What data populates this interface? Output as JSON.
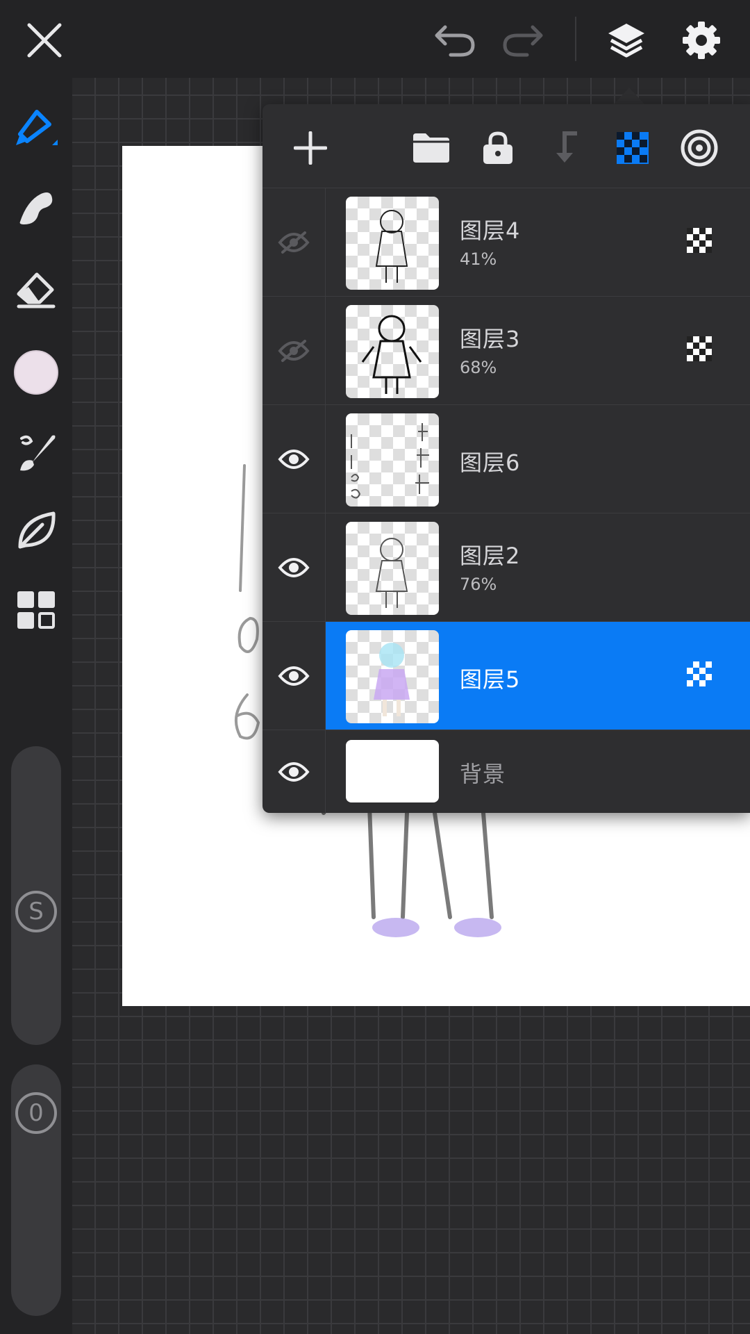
{
  "colors": {
    "accent": "#0a7bf5",
    "current_brush_color": "#ece0ea",
    "panel_bg": "#2e2e30",
    "canvas_paper": "#ffffff"
  },
  "topbar": {
    "icons": [
      "close-icon",
      "undo-icon",
      "redo-icon",
      "layers-icon",
      "settings-icon"
    ]
  },
  "sidebar": {
    "tools": [
      "pen-icon",
      "smudge-icon",
      "eraser-icon",
      "color-swatch",
      "brush-library-icon",
      "leaf-icon",
      "grid-icon"
    ],
    "size_slider_label": "S",
    "opacity_slider_label": "0"
  },
  "layers_panel": {
    "toolbar_icons": [
      "add-layer-icon",
      "folder-icon",
      "lock-icon",
      "clip-icon",
      "alpha-lock-icon",
      "blend-mode-icon"
    ],
    "layers": [
      {
        "name": "图层4",
        "opacity": "41%",
        "visible": false,
        "selected": false,
        "blend_icon": true
      },
      {
        "name": "图层3",
        "opacity": "68%",
        "visible": false,
        "selected": false,
        "blend_icon": true
      },
      {
        "name": "图层6",
        "opacity": "",
        "visible": true,
        "selected": false,
        "blend_icon": false
      },
      {
        "name": "图层2",
        "opacity": "76%",
        "visible": true,
        "selected": false,
        "blend_icon": false
      },
      {
        "name": "图层5",
        "opacity": "",
        "visible": true,
        "selected": true,
        "blend_icon": true
      },
      {
        "name": "背景",
        "opacity": "",
        "visible": true,
        "selected": false,
        "blend_icon": false
      }
    ]
  }
}
